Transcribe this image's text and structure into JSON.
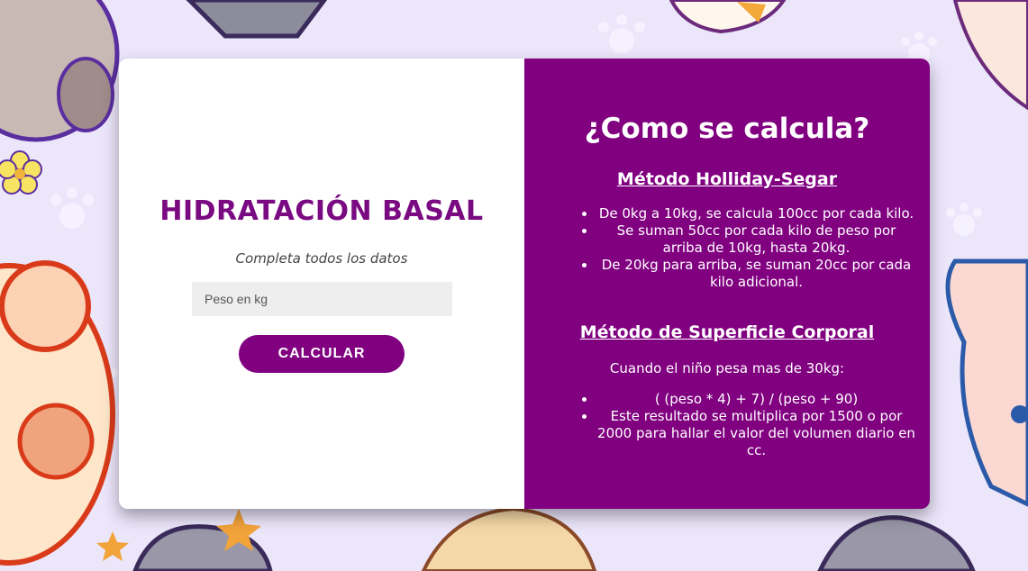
{
  "left_panel": {
    "title": "HIDRATACIÓN BASAL",
    "subtitle": "Completa todos los datos",
    "weight_input": {
      "placeholder": "Peso en kg",
      "value": ""
    },
    "calculate_button": "CALCULAR"
  },
  "right_panel": {
    "title": "¿Como se calcula?",
    "method1": {
      "title": "Método Holliday-Segar",
      "items": [
        "De 0kg a 10kg, se calcula 100cc por cada kilo.",
        "Se suman 50cc por cada kilo de peso por arriba de 10kg, hasta 20kg.",
        "De 20kg para arriba, se suman 20cc por cada kilo adicional."
      ]
    },
    "method2": {
      "title": "Método de Superficie Corporal",
      "condition": "Cuando el niño pesa mas de 30kg:",
      "items": [
        "( (peso * 4) + 7) / (peso + 90)",
        "Este resultado se multiplica por 1500 o por 2000 para hallar el valor del volumen diario en cc."
      ]
    }
  },
  "colors": {
    "accent": "#800080",
    "title": "#7a0a82",
    "background": "#ece6fb",
    "input_bg": "#eeeeee"
  }
}
